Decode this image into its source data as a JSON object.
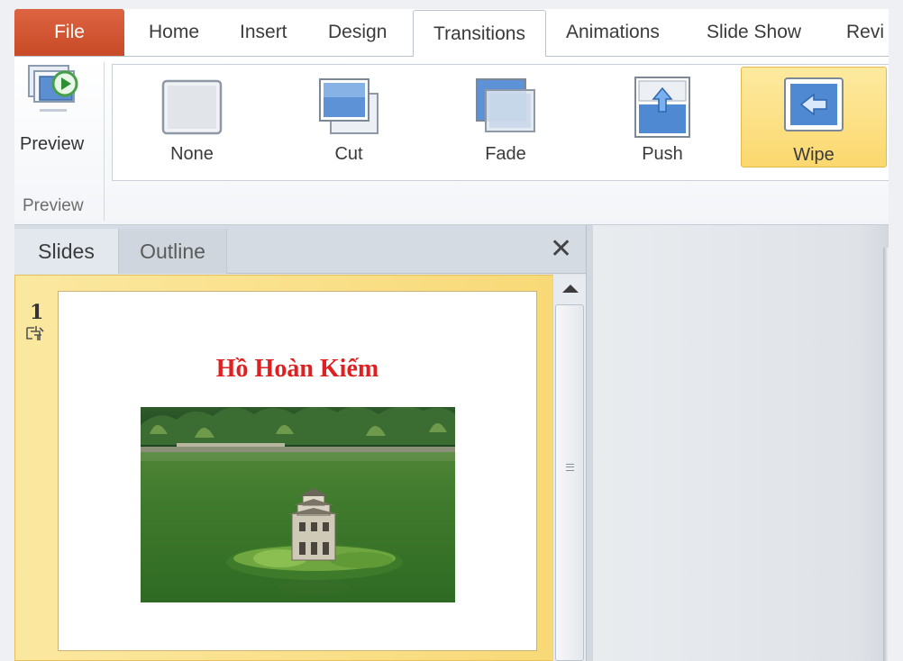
{
  "ribbon_tabs": {
    "file": "File",
    "home": "Home",
    "insert": "Insert",
    "design": "Design",
    "transitions": "Transitions",
    "animations": "Animations",
    "slide_show": "Slide Show",
    "review": "Revi"
  },
  "active_tab": "Transitions",
  "preview_group": {
    "button_label": "Preview",
    "group_label": "Preview"
  },
  "transition_gallery": [
    {
      "label": "None",
      "icon": "none-transition-icon",
      "selected": false
    },
    {
      "label": "Cut",
      "icon": "cut-transition-icon",
      "selected": false
    },
    {
      "label": "Fade",
      "icon": "fade-transition-icon",
      "selected": false
    },
    {
      "label": "Push",
      "icon": "push-transition-icon",
      "selected": false
    },
    {
      "label": "Wipe",
      "icon": "wipe-transition-icon",
      "selected": true
    }
  ],
  "slides_panel": {
    "tab_slides": "Slides",
    "tab_outline": "Outline",
    "close_glyph": "✕",
    "slides": [
      {
        "number": "1",
        "title": "Hồ Hoàn Kiếm"
      }
    ]
  },
  "colors": {
    "file_tab": "#d4542f",
    "selection": "#fbd86e",
    "slide_title": "#e02020"
  }
}
